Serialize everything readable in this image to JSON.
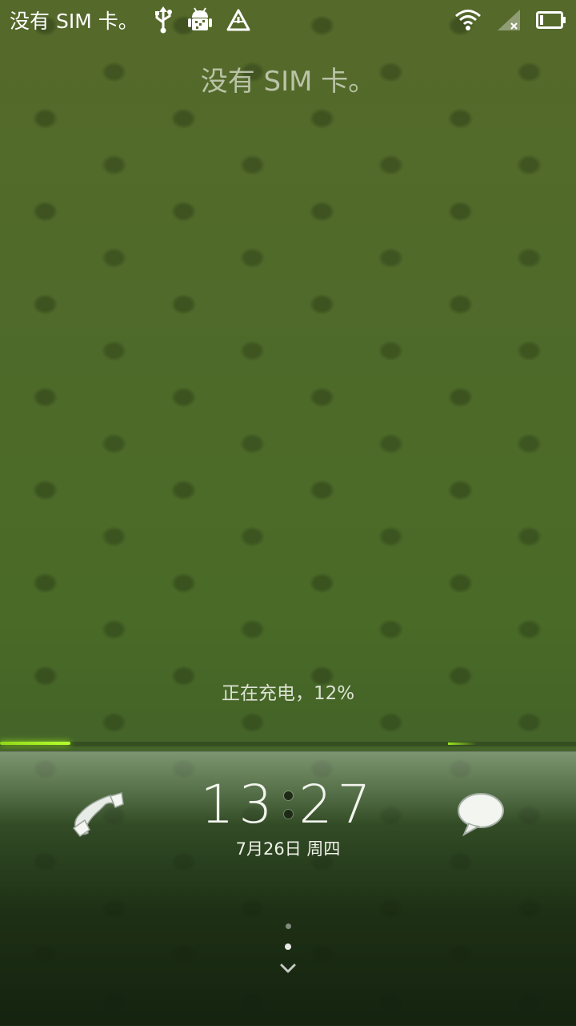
{
  "status_bar": {
    "carrier_text": "没有 SIM 卡。",
    "icons_left": [
      "usb-icon",
      "android-debug-icon",
      "warning-triangle-icon"
    ],
    "icons_right": [
      "wifi-icon",
      "no-signal-icon",
      "battery-icon"
    ],
    "battery_level": 0.12
  },
  "lockscreen": {
    "carrier_label": "没有 SIM 卡。",
    "charging_status": "正在充电，12%",
    "time_hours": "13",
    "time_minutes": "27",
    "date": "7月26日 周四",
    "left_action": "phone-icon",
    "right_action": "message-icon",
    "scroll_hint": "chevron-down-icon"
  },
  "colors": {
    "accent_glow": "#9be620",
    "background": "#4f6a2a"
  }
}
